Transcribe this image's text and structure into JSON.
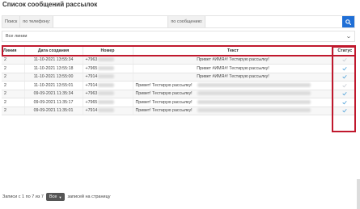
{
  "title": "Список сообщений рассылок",
  "search": {
    "label": "Поиск",
    "phone_label": "по телефону:",
    "message_label": "по сообщению:"
  },
  "filter": {
    "selected": "Все линии"
  },
  "table": {
    "headers": {
      "line": "Линия",
      "date": "Дата создания",
      "number": "Номер",
      "text": "Текст",
      "status": "Статус"
    },
    "rows": [
      {
        "line": "2",
        "date": "11-10-2021 13:55:34",
        "number": "+7963",
        "text": "Привет #ИМЯ#! Тестирую рассылку!",
        "centered": true,
        "status_color": "#c6cbd2"
      },
      {
        "line": "2",
        "date": "11-10-2021 13:55:18",
        "number": "+7965",
        "text": "Привет #ИМЯ#! Тестирую рассылку!",
        "centered": true,
        "status_color": "#4a9fd8"
      },
      {
        "line": "2",
        "date": "11-10-2021 13:55:00",
        "number": "+7914",
        "text": "Привет #ИМЯ#! Тестирую рассылку!",
        "centered": true,
        "status_color": "#4a9fd8"
      },
      {
        "line": "2",
        "date": "11-10-2021 13:55:01",
        "number": "+7914",
        "text": "Привет! Тестирую рассылку!",
        "centered": false,
        "status_color": "#c6cbd2"
      },
      {
        "line": "2",
        "date": "09-09-2021 11:35:34",
        "number": "+7963",
        "text": "Привет! Тестирую рассылку!",
        "centered": false,
        "status_color": "#4a9fd8"
      },
      {
        "line": "2",
        "date": "09-09-2021 11:35:17",
        "number": "+7965",
        "text": "Привет! Тестирую рассылку!",
        "centered": false,
        "status_color": "#4a9fd8"
      },
      {
        "line": "2",
        "date": "09-09-2021 11:35:01",
        "number": "+7914",
        "text": "Привет! Тестирую рассылку!",
        "centered": false,
        "status_color": "#4a9fd8"
      }
    ]
  },
  "footer": {
    "records": "Записи с 1 по 7 из 7",
    "page_size": "Все",
    "suffix": "записей на страницу"
  },
  "colors": {
    "accent": "#1f6fd6",
    "highlight": "#c0182d"
  }
}
